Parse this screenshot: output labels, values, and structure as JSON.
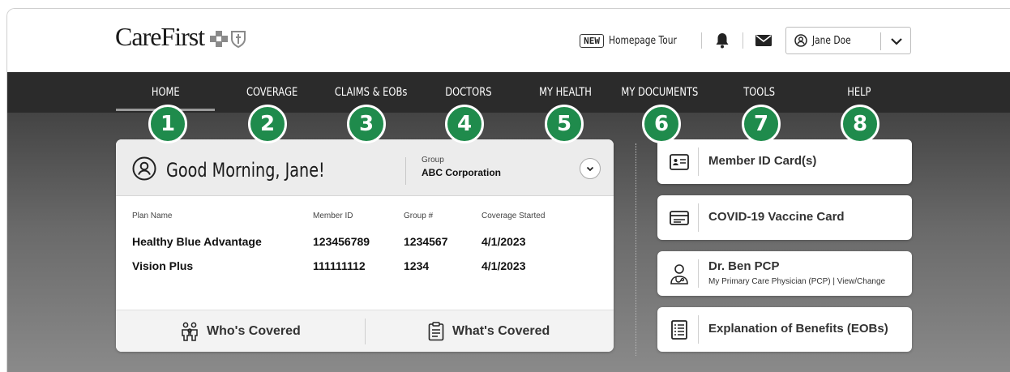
{
  "brand": {
    "name": "CareFirst"
  },
  "header": {
    "new_badge": "NEW",
    "tour_label": "Homepage Tour",
    "user_name": "Jane Doe"
  },
  "nav": {
    "items": [
      {
        "label": "HOME",
        "number": "1"
      },
      {
        "label": "COVERAGE",
        "number": "2"
      },
      {
        "label": "CLAIMS & EOBs",
        "number": "3"
      },
      {
        "label": "DOCTORS",
        "number": "4"
      },
      {
        "label": "MY HEALTH",
        "number": "5"
      },
      {
        "label": "MY DOCUMENTS",
        "number": "6"
      },
      {
        "label": "TOOLS",
        "number": "7"
      },
      {
        "label": "HELP",
        "number": "8"
      }
    ],
    "active": "HOME"
  },
  "summary_card": {
    "greeting": "Good Morning, Jane!",
    "group_label": "Group",
    "group_value": "ABC Corporation",
    "columns": [
      "Plan Name",
      "Member ID",
      "Group #",
      "Coverage Started"
    ],
    "rows": [
      [
        "Healthy Blue Advantage",
        "123456789",
        "1234567",
        "4/1/2023"
      ],
      [
        "Vision Plus",
        "111111112",
        "1234",
        "4/1/2023"
      ]
    ],
    "footer": {
      "whos_covered": "Who's Covered",
      "whats_covered": "What's Covered"
    }
  },
  "quick_links": [
    {
      "label": "Member ID Card(s)",
      "icon": "id-card-icon"
    },
    {
      "label": "COVID-19 Vaccine Card",
      "icon": "card-icon"
    },
    {
      "label": "Dr. Ben PCP",
      "sub": "My Primary Care Physician (PCP)",
      "sub_divider": "|",
      "sub_link": "View/Change",
      "icon": "doctor-icon"
    },
    {
      "label": "Explanation of Benefits (EOBs)",
      "icon": "document-list-icon"
    }
  ],
  "colors": {
    "nav_bg": "#2b2b2b",
    "step_badge": "#1f8b4c",
    "brand_blue": "#2456a6"
  }
}
